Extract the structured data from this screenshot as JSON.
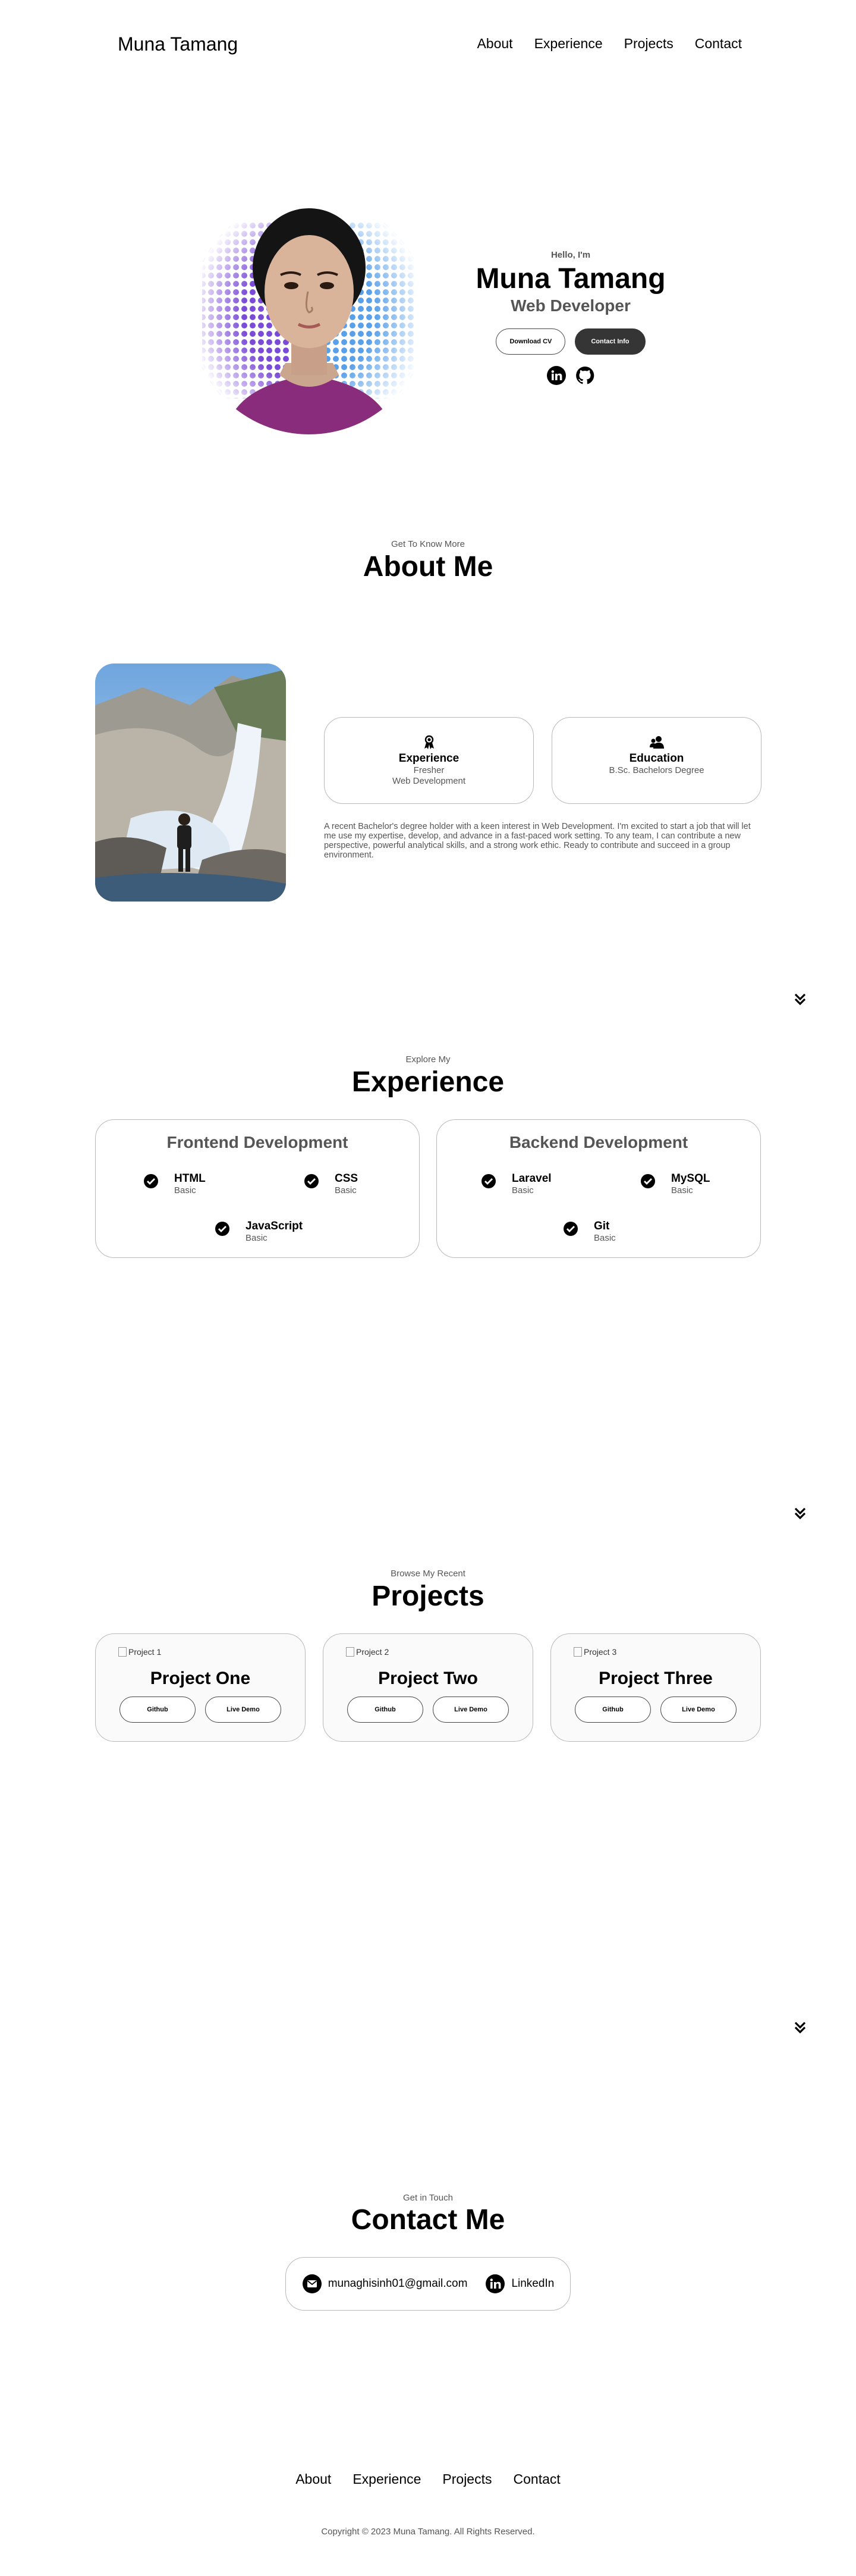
{
  "nav": {
    "logo": "Muna Tamang",
    "links": [
      "About",
      "Experience",
      "Projects",
      "Contact"
    ]
  },
  "hero": {
    "hello": "Hello, I'm",
    "name": "Muna Tamang",
    "role": "Web Developer",
    "download_cv": "Download CV",
    "contact_info": "Contact Info",
    "socials": [
      "linkedin-icon",
      "github-icon"
    ]
  },
  "about": {
    "subtitle": "Get To Know More",
    "title": "About Me",
    "experience": {
      "title": "Experience",
      "line1": "Fresher",
      "line2": "Web Development"
    },
    "education": {
      "title": "Education",
      "line1": "B.Sc. Bachelors Degree"
    },
    "text": "A recent Bachelor's degree holder with a keen interest in Web Development. I'm excited to start a job that will let me use my expertise, develop, and advance in a fast-paced work setting. To any team, I can contribute a new perspective, powerful analytical skills, and a strong work ethic. Ready to contribute and succeed in a group environment."
  },
  "experience": {
    "subtitle": "Explore My",
    "title": "Experience",
    "frontend": {
      "title": "Frontend Development",
      "skills": [
        {
          "name": "HTML",
          "level": "Basic"
        },
        {
          "name": "CSS",
          "level": "Basic"
        },
        {
          "name": "JavaScript",
          "level": "Basic"
        }
      ]
    },
    "backend": {
      "title": "Backend Development",
      "skills": [
        {
          "name": "Laravel",
          "level": "Basic"
        },
        {
          "name": "MySQL",
          "level": "Basic"
        },
        {
          "name": "Git",
          "level": "Basic"
        }
      ]
    }
  },
  "projects": {
    "subtitle": "Browse My Recent",
    "title": "Projects",
    "items": [
      {
        "img_alt": "Project 1",
        "title": "Project One",
        "github": "Github",
        "demo": "Live Demo"
      },
      {
        "img_alt": "Project 2",
        "title": "Project Two",
        "github": "Github",
        "demo": "Live Demo"
      },
      {
        "img_alt": "Project 3",
        "title": "Project Three",
        "github": "Github",
        "demo": "Live Demo"
      }
    ]
  },
  "contact": {
    "subtitle": "Get in Touch",
    "title": "Contact Me",
    "email": "munaghisinh01@gmail.com",
    "linkedin": "LinkedIn"
  },
  "footer": {
    "links": [
      "About",
      "Experience",
      "Projects",
      "Contact"
    ],
    "copyright": "Copyright © 2023 Muna Tamang. All Rights Reserved."
  },
  "colors": {
    "text": "#000000",
    "muted": "#555555",
    "button_dark": "#353535",
    "card_border": "#b8b8b8"
  }
}
